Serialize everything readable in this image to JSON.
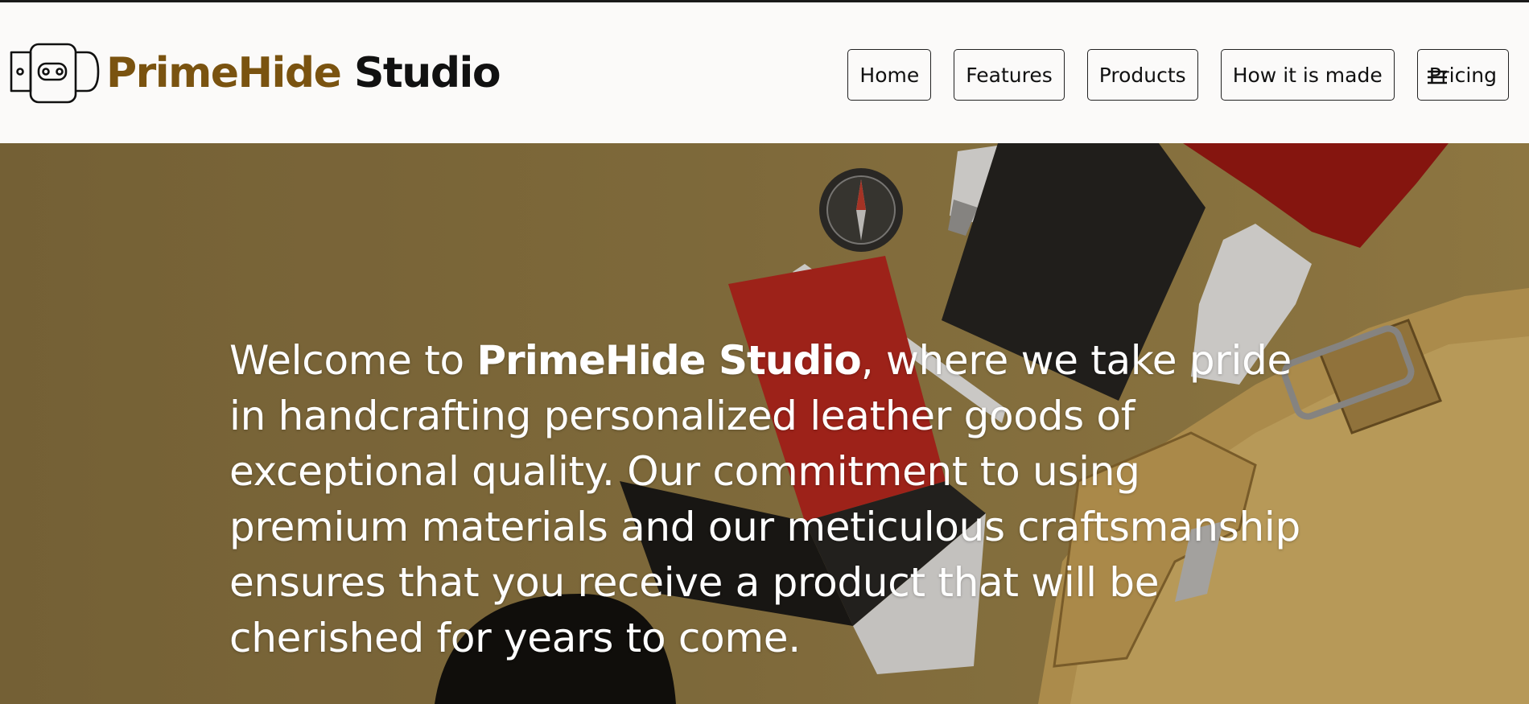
{
  "header": {
    "logo_icon": "belt-buckle-icon",
    "brand_part1": "PrimeHide",
    "brand_part2": "Studio",
    "brand_color": "#7a5310",
    "nav": [
      {
        "label": "Home"
      },
      {
        "label": "Features"
      },
      {
        "label": "Products"
      },
      {
        "label": "How it is made"
      },
      {
        "label": "Pricing"
      }
    ],
    "menu_icon": "hamburger-menu-icon"
  },
  "hero": {
    "text_before": "Welcome to ",
    "text_bold": "PrimeHide Studio",
    "text_after": ", where we take pride in handcrafting personalized leather goods of exceptional quality. Our commitment to using premium materials and our meticulous craftsmanship ensures that you receive a product that will be cherished for years to come.",
    "background_color": "#8e7845"
  }
}
